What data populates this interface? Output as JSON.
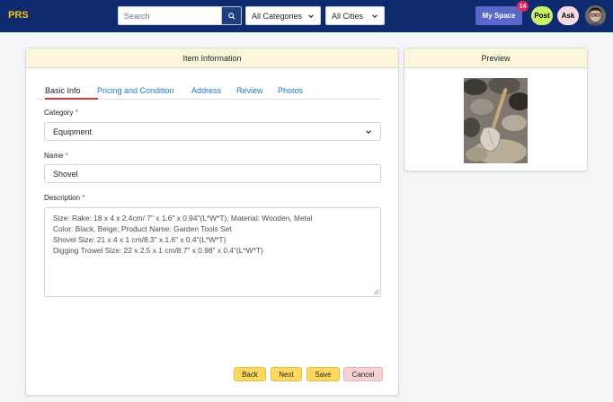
{
  "navbar": {
    "brand": "PRS",
    "search_placeholder": "Search",
    "category_select": "All Categories",
    "city_select": "All Cities",
    "myspace_label": "My Space",
    "notification_count": "14",
    "post_label": "Post",
    "ask_label": "Ask"
  },
  "item_card": {
    "header": "Item Information",
    "tabs": [
      {
        "label": "Basic Info",
        "active": true
      },
      {
        "label": "Pricing and Condition",
        "active": false
      },
      {
        "label": "Address",
        "active": false
      },
      {
        "label": "Review",
        "active": false
      },
      {
        "label": "Photos",
        "active": false
      }
    ],
    "category_label": "Category",
    "category_value": "Equipment",
    "name_label": "Name",
    "name_value": "Shovel",
    "description_label": "Description",
    "required_marker": "*",
    "description_lines": [
      "Size: Rake: 18 x 4 x 2.4cm/ 7\" x 1.6\" x 0.94\"(L*W*T); Material: Wooden, Metal",
      "Color: Black, Beige; Product Name: Garden Tools Set",
      "Shovel Size: 21 x 4 x 1 cm/8.3\" x 1.6\" x 0.4\"(L*W*T)",
      "Digging Trowel Size: 22 x 2.5 x 1 cm/8.7\" x 0.98\" x 0.4\"(L*W*T)"
    ],
    "buttons": {
      "back": "Back",
      "next": "Next",
      "save": "Save",
      "cancel": "Cancel"
    }
  },
  "preview_card": {
    "header": "Preview",
    "image_icon": "shovel-photo"
  },
  "colors": {
    "navbar_bg": "#0d2b6e",
    "brand": "#ffc107",
    "card_header_bg": "#fcf6dc",
    "tab_active_underline": "#d43a3a",
    "link": "#1e7ad1",
    "primary_button": "#ffd95e",
    "cancel_button": "#f7d1d5",
    "myspace_button": "#5a67c9",
    "post_button": "#ccf26b",
    "ask_button": "#f6dce1",
    "badge": "#e0245e"
  }
}
